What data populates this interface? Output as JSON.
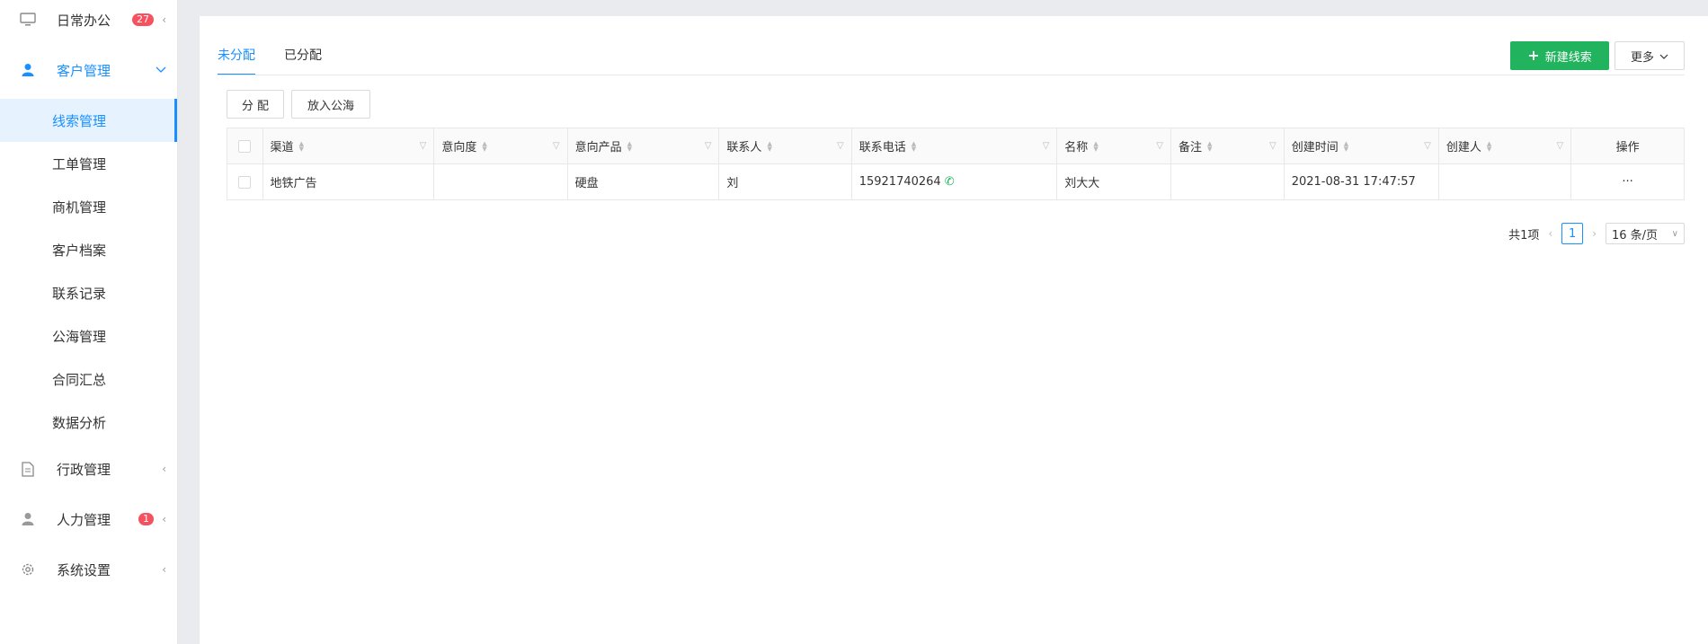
{
  "sidebar": {
    "groups": [
      {
        "label": "日常办公",
        "icon": "monitor-icon",
        "badge": "27",
        "arrow": "‹"
      },
      {
        "label": "客户管理",
        "icon": "user-icon",
        "arrow": "⌄"
      },
      {
        "label": "行政管理",
        "icon": "document-icon",
        "arrow": "‹"
      },
      {
        "label": "人力管理",
        "icon": "person-icon",
        "badge": "1",
        "arrow": "‹"
      },
      {
        "label": "系统设置",
        "icon": "gear-icon",
        "arrow": "‹"
      }
    ],
    "subitems": [
      "线索管理",
      "工单管理",
      "商机管理",
      "客户档案",
      "联系记录",
      "公海管理",
      "合同汇总",
      "数据分析"
    ],
    "selected_subitem": "线索管理"
  },
  "tabs": [
    "未分配",
    "已分配"
  ],
  "active_tab": "未分配",
  "toolbar": {
    "new_label": "新建线索",
    "more_label": "更多",
    "assign_label": "分 配",
    "public_label": "放入公海"
  },
  "table": {
    "columns": [
      "渠道",
      "意向度",
      "意向产品",
      "联系人",
      "联系电话",
      "名称",
      "备注",
      "创建时间",
      "创建人",
      "操作"
    ],
    "rows": [
      {
        "channel": "地铁广告",
        "intent": "",
        "product": "硬盘",
        "contact": "刘",
        "phone": "15921740264",
        "name": "刘大大",
        "remark": "",
        "created_at": "2021-08-31 17:47:57",
        "creator": "",
        "action": "···"
      }
    ]
  },
  "pagination": {
    "total": "共1项",
    "current": "1",
    "page_size": "16 条/页"
  },
  "colors": {
    "accent": "#1890ff",
    "primary_button": "#21b35e",
    "badge": "#f5515f"
  }
}
